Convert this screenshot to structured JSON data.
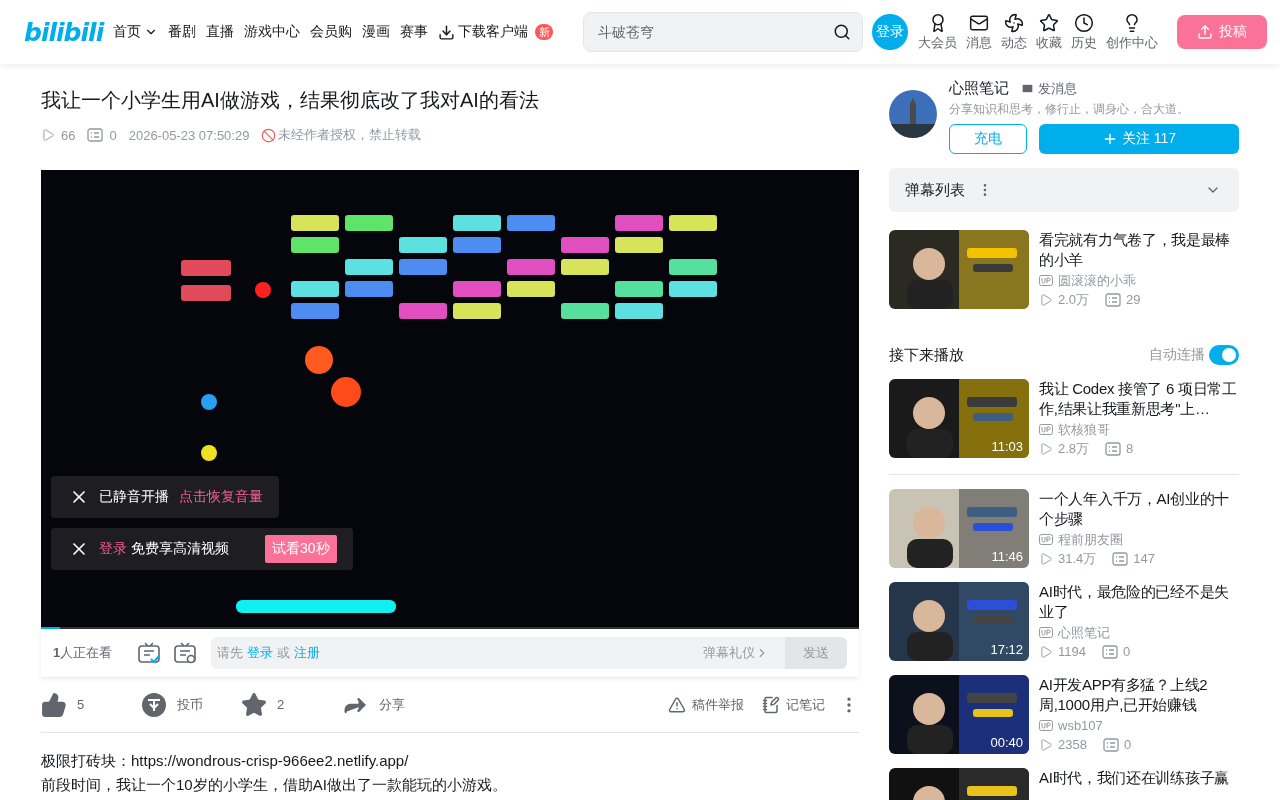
{
  "header": {
    "logo": "bilibili",
    "nav": [
      {
        "label": "首页",
        "kind": "dropdown"
      },
      {
        "label": "番剧",
        "kind": "plain"
      },
      {
        "label": "直播",
        "kind": "plain"
      },
      {
        "label": "游戏中心",
        "kind": "plain"
      },
      {
        "label": "会员购",
        "kind": "plain"
      },
      {
        "label": "漫画",
        "kind": "plain"
      },
      {
        "label": "赛事",
        "kind": "plain"
      },
      {
        "label": "下载客户端",
        "kind": "download",
        "badge": "新"
      }
    ],
    "search": {
      "placeholder": "斗破苍穹"
    },
    "login": "登录",
    "icons": [
      {
        "label": "大会员",
        "kind": "vip"
      },
      {
        "label": "消息",
        "kind": "message"
      },
      {
        "label": "动态",
        "kind": "feed"
      },
      {
        "label": "收藏",
        "kind": "favorite"
      },
      {
        "label": "历史",
        "kind": "history"
      },
      {
        "label": "创作中心",
        "kind": "creator"
      }
    ],
    "upload": "投稿"
  },
  "video": {
    "title": "我让一个小学生用AI做游戏，结果彻底改了我对AI的看法",
    "views": "66",
    "danmaku": "0",
    "date": "2026-05-23 07:50:29",
    "notice": "未经作者授权，禁止转载"
  },
  "player": {
    "kind": "picture",
    "level": 0.023,
    "muted_notice": {
      "text": "已静音开播",
      "action": "点击恢复音量"
    },
    "login_notice": {
      "link": "登录",
      "text": "免费享高清视频",
      "button": "试看30秒"
    },
    "viewers": {
      "count": "1",
      "label": "人正在看"
    },
    "danmaku_input": {
      "prefix": "请先",
      "login": "登录",
      "or": "或",
      "register": "注册",
      "etiquette": "弹幕礼仪",
      "send": "发送"
    }
  },
  "actions": [
    {
      "kind": "like",
      "label": "5"
    },
    {
      "kind": "coin",
      "label": "投币"
    },
    {
      "kind": "favorite",
      "label": "2"
    },
    {
      "kind": "share",
      "label": "分享"
    }
  ],
  "tools": [
    {
      "kind": "report",
      "label": "稿件举报"
    },
    {
      "kind": "note",
      "label": "记笔记"
    }
  ],
  "description": [
    "极限打砖块：https://wondrous-crisp-966ee2.netlify.app/",
    "前段时间，我让一个10岁的小学生，借助AI做出了一款能玩的小游戏。"
  ],
  "uploader": {
    "name": "心照笔记",
    "message": "发消息",
    "bio": "分享知识和思考，修行止，调身心，合大道。",
    "charge": "充电",
    "follow": "关注 117"
  },
  "danmaku_list": {
    "title": "弹幕列表"
  },
  "featured": {
    "title": "看完就有力气卷了，我是最棒的小羊",
    "author": "圆滚滚的小乖",
    "views": "2.0万",
    "danmaku": "29"
  },
  "up_next": {
    "title": "接下来播放",
    "autoplay_label": "自动连播",
    "autoplay": true
  },
  "recommendations": [
    {
      "title": "我让 Codex 接管了 6 项日常工作,结果让我重新思考\"上…",
      "author": "软核狼哥",
      "views": "2.8万",
      "danmaku": "8",
      "duration": "11:03"
    },
    {
      "title": "一个人年入千万，AI创业的十个步骤",
      "author": "程前朋友圈",
      "views": "31.4万",
      "danmaku": "147",
      "duration": "11:46"
    },
    {
      "title": "AI时代，最危险的已经不是失业了",
      "author": "心照笔记",
      "views": "1194",
      "danmaku": "0",
      "duration": "17:12"
    },
    {
      "title": "AI开发APP有多猛？上线2周,1000用户,已开始赚钱",
      "author": "wsb107",
      "views": "2358",
      "danmaku": "0",
      "duration": "00:40"
    },
    {
      "title": "AI时代，我们还在训练孩子赢"
    }
  ]
}
